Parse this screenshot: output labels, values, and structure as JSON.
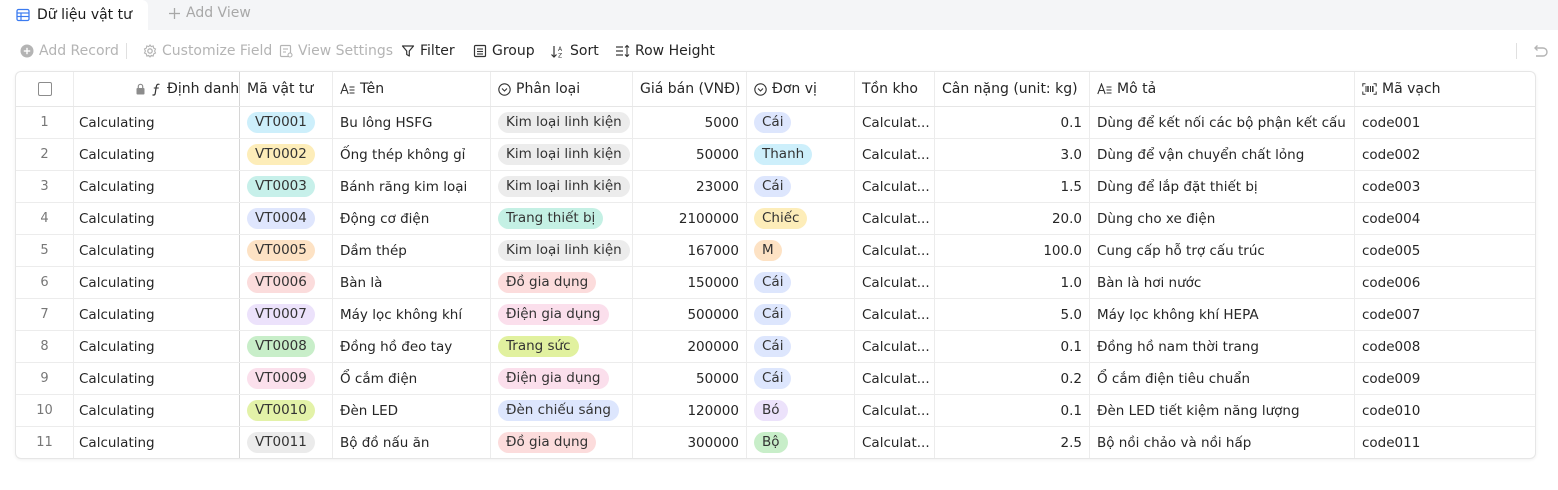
{
  "tabs": {
    "active_label": "Dữ liệu vật tư",
    "add_view_label": "Add View"
  },
  "toolbar": {
    "add_record": "Add Record",
    "customize_field": "Customize Field",
    "view_settings": "View Settings",
    "filter": "Filter",
    "group": "Group",
    "sort": "Sort",
    "row_height": "Row Height"
  },
  "columns": {
    "dinh_danh": "Định danh",
    "ma_vat_tu": "Mã vật tư",
    "ten": "Tên",
    "phan_loai": "Phân loại",
    "gia_ban": "Giá bán (VNĐ)",
    "don_vi": "Đơn vị",
    "ton_kho": "Tồn kho",
    "can_nang": "Cân nặng (unit: kg)",
    "mo_ta": "Mô tả",
    "ma_vach": "Mã vạch"
  },
  "colors": {
    "code_pills": [
      "#cdeffb",
      "#fdedb9",
      "#c7f0ea",
      "#dfe6fd",
      "#fde2c4",
      "#fbdcdc",
      "#ece2fb",
      "#c8eec9",
      "#fbe0ec",
      "#e3f2a8",
      "#ebebeb"
    ],
    "cat_pills": {
      "Kim loại linh kiện": "#ececec",
      "Trang thiết bị": "#c4f0e4",
      "Đồ gia dụng": "#fcdcdc",
      "Điện gia dụng": "#fbdfec",
      "Trang sức": "#e1f19f",
      "Đèn chiếu sáng": "#dde6fd"
    },
    "unit_pills": {
      "Cái": "#dde6fd",
      "Thanh": "#cdeffb",
      "Chiếc": "#fdedb9",
      "M": "#fde2c4",
      "Bó": "#ece2fb",
      "Bộ": "#c8eec9"
    }
  },
  "rows": [
    {
      "idx": "1",
      "dinh_danh": "Calculating",
      "ma": "VT0001",
      "ten": "Bu lông HSFG",
      "phan_loai": "Kim loại linh kiện",
      "gia": "5000",
      "don_vi": "Cái",
      "ton_kho": "Calculat...",
      "can_nang": "0.1",
      "mo_ta": "Dùng để kết nối các bộ phận kết cấu",
      "ma_vach": "code001"
    },
    {
      "idx": "2",
      "dinh_danh": "Calculating",
      "ma": "VT0002",
      "ten": "Ống thép không gỉ",
      "phan_loai": "Kim loại linh kiện",
      "gia": "50000",
      "don_vi": "Thanh",
      "ton_kho": "Calculat...",
      "can_nang": "3.0",
      "mo_ta": "Dùng để vận chuyển chất lỏng",
      "ma_vach": "code002"
    },
    {
      "idx": "3",
      "dinh_danh": "Calculating",
      "ma": "VT0003",
      "ten": "Bánh răng kim loại",
      "phan_loai": "Kim loại linh kiện",
      "gia": "23000",
      "don_vi": "Cái",
      "ton_kho": "Calculat...",
      "can_nang": "1.5",
      "mo_ta": "Dùng để lắp đặt thiết bị",
      "ma_vach": "code003"
    },
    {
      "idx": "4",
      "dinh_danh": "Calculating",
      "ma": "VT0004",
      "ten": "Động cơ điện",
      "phan_loai": "Trang thiết bị",
      "gia": "2100000",
      "don_vi": "Chiếc",
      "ton_kho": "Calculat...",
      "can_nang": "20.0",
      "mo_ta": "Dùng cho xe điện",
      "ma_vach": "code004"
    },
    {
      "idx": "5",
      "dinh_danh": "Calculating",
      "ma": "VT0005",
      "ten": "Dầm thép",
      "phan_loai": "Kim loại linh kiện",
      "gia": "167000",
      "don_vi": "M",
      "ton_kho": "Calculat...",
      "can_nang": "100.0",
      "mo_ta": "Cung cấp hỗ trợ cấu trúc",
      "ma_vach": "code005"
    },
    {
      "idx": "6",
      "dinh_danh": "Calculating",
      "ma": "VT0006",
      "ten": "Bàn là",
      "phan_loai": "Đồ gia dụng",
      "gia": "150000",
      "don_vi": "Cái",
      "ton_kho": "Calculat...",
      "can_nang": "1.0",
      "mo_ta": "Bàn là hơi nước",
      "ma_vach": "code006"
    },
    {
      "idx": "7",
      "dinh_danh": "Calculating",
      "ma": "VT0007",
      "ten": "Máy lọc không khí",
      "phan_loai": "Điện gia dụng",
      "gia": "500000",
      "don_vi": "Cái",
      "ton_kho": "Calculat...",
      "can_nang": "5.0",
      "mo_ta": "Máy lọc không khí HEPA",
      "ma_vach": "code007"
    },
    {
      "idx": "8",
      "dinh_danh": "Calculating",
      "ma": "VT0008",
      "ten": "Đồng hồ đeo tay",
      "phan_loai": "Trang sức",
      "gia": "200000",
      "don_vi": "Cái",
      "ton_kho": "Calculat...",
      "can_nang": "0.1",
      "mo_ta": "Đồng hồ nam thời trang",
      "ma_vach": "code008"
    },
    {
      "idx": "9",
      "dinh_danh": "Calculating",
      "ma": "VT0009",
      "ten": "Ổ cắm điện",
      "phan_loai": "Điện gia dụng",
      "gia": "50000",
      "don_vi": "Cái",
      "ton_kho": "Calculat...",
      "can_nang": "0.2",
      "mo_ta": "Ổ cắm điện tiêu chuẩn",
      "ma_vach": "code009"
    },
    {
      "idx": "10",
      "dinh_danh": "Calculating",
      "ma": "VT0010",
      "ten": "Đèn LED",
      "phan_loai": "Đèn chiếu sáng",
      "gia": "120000",
      "don_vi": "Bó",
      "ton_kho": "Calculat...",
      "can_nang": "0.1",
      "mo_ta": "Đèn LED tiết kiệm năng lượng",
      "ma_vach": "code010"
    },
    {
      "idx": "11",
      "dinh_danh": "Calculating",
      "ma": "VT0011",
      "ten": "Bộ đồ nấu ăn",
      "phan_loai": "Đồ gia dụng",
      "gia": "300000",
      "don_vi": "Bộ",
      "ton_kho": "Calculat...",
      "can_nang": "2.5",
      "mo_ta": "Bộ nồi chảo và nồi hấp",
      "ma_vach": "code011"
    }
  ]
}
